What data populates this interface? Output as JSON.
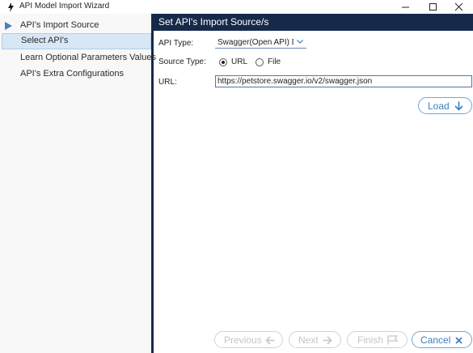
{
  "window": {
    "title": "API Model Import Wizard",
    "minimize_icon": "minimize-icon",
    "maximize_icon": "maximize-icon",
    "close_icon": "close-icon"
  },
  "sidebar": {
    "items": [
      {
        "label": "API's Import Source",
        "current": true
      },
      {
        "label": "Select API's",
        "selected": true
      },
      {
        "label": "Learn Optional Parameters Values"
      },
      {
        "label": "API's Extra Configurations"
      }
    ]
  },
  "main": {
    "header": "Set API's Import Source/s",
    "api_type": {
      "label": "API Type:",
      "value": "Swagger(Open API) Doc"
    },
    "source_type": {
      "label": "Source Type:",
      "options": [
        {
          "label": "URL",
          "checked": true
        },
        {
          "label": "File",
          "checked": false
        }
      ]
    },
    "url": {
      "label": "URL:",
      "value": "https://petstore.swagger.io/v2/swagger.json"
    },
    "load_button": "Load"
  },
  "footer": {
    "previous": "Previous",
    "next": "Next",
    "finish": "Finish",
    "cancel": "Cancel"
  },
  "colors": {
    "header_bg": "#16294a",
    "accent": "#3d7fc0",
    "selected_bg": "#d7e7f5"
  }
}
